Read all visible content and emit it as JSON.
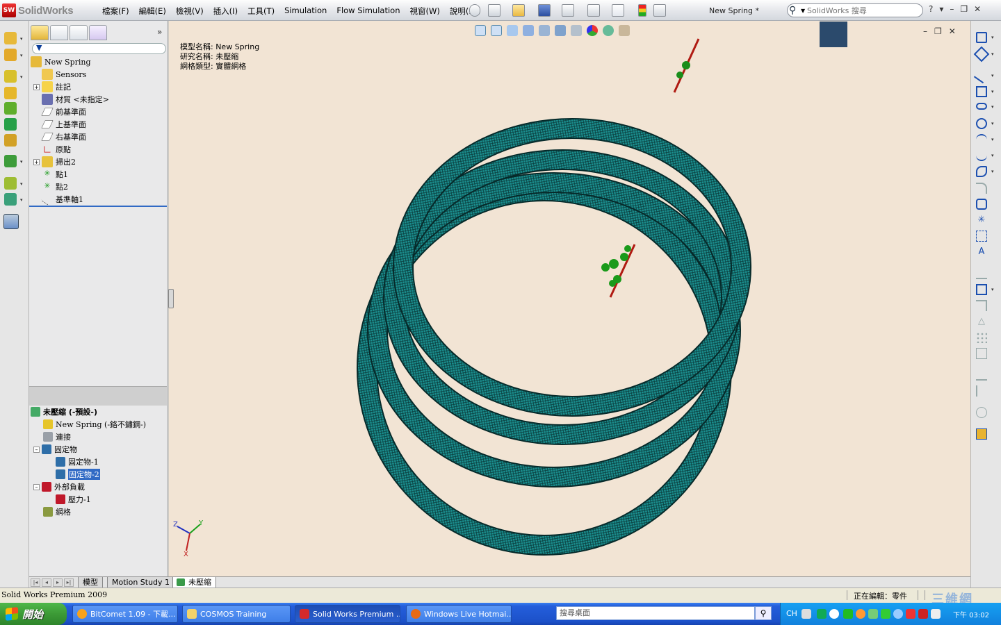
{
  "app": {
    "logo_text": "SolidWorks",
    "logo_badge": "SW",
    "document_title": "New Spring *",
    "menus": [
      "檔案(F)",
      "編輯(E)",
      "檢視(V)",
      "插入(I)",
      "工具(T)",
      "Simulation",
      "Flow Simulation",
      "視窗(W)",
      "說明(H)"
    ],
    "search_placeholder": "SolidWorks 搜尋",
    "window_controls": [
      "?",
      "▾",
      "–",
      "❐",
      "✕"
    ]
  },
  "feature_tree": {
    "root": "New Spring",
    "items": [
      {
        "label": "Sensors",
        "icon": "sensors-icon",
        "expandable": false
      },
      {
        "label": "註記",
        "icon": "annotations-icon",
        "expandable": true
      },
      {
        "label": "材質 <未指定>",
        "icon": "material-icon",
        "expandable": false
      },
      {
        "label": "前基準面",
        "icon": "plane-icon",
        "expandable": false
      },
      {
        "label": "上基準面",
        "icon": "plane-icon",
        "expandable": false
      },
      {
        "label": "右基準面",
        "icon": "plane-icon",
        "expandable": false
      },
      {
        "label": "原點",
        "icon": "origin-icon",
        "expandable": false
      },
      {
        "label": "掃出2",
        "icon": "sweep-icon",
        "expandable": true
      },
      {
        "label": "點1",
        "icon": "point-icon",
        "expandable": false
      },
      {
        "label": "點2",
        "icon": "point-icon",
        "expandable": false
      },
      {
        "label": "基準軸1",
        "icon": "axis-icon",
        "expandable": false
      }
    ]
  },
  "study_tree": {
    "root": "未壓縮 (-預設-)",
    "items": [
      {
        "label": "New Spring (-鉻不鏽鋼-)",
        "icon": "part-icon",
        "indent": 1,
        "expandable": false,
        "selected": false
      },
      {
        "label": "連接",
        "icon": "connections-icon",
        "indent": 1,
        "expandable": false,
        "selected": false
      },
      {
        "label": "固定物",
        "icon": "fixtures-icon",
        "indent": 1,
        "expandable": true,
        "selected": false
      },
      {
        "label": "固定物-1",
        "icon": "fixture-icon",
        "indent": 2,
        "expandable": false,
        "selected": false
      },
      {
        "label": "固定物-2",
        "icon": "fixture-icon",
        "indent": 2,
        "expandable": false,
        "selected": true
      },
      {
        "label": "外部負載",
        "icon": "external-loads-icon",
        "indent": 1,
        "expandable": true,
        "selected": false
      },
      {
        "label": "壓力-1",
        "icon": "pressure-icon",
        "indent": 2,
        "expandable": false,
        "selected": false
      },
      {
        "label": "網格",
        "icon": "mesh-icon",
        "indent": 1,
        "expandable": false,
        "selected": false
      }
    ]
  },
  "viewport": {
    "info": [
      "模型名稱: New Spring",
      "研究名稱: 未壓縮",
      "網格類型: 實體網格"
    ],
    "background": "#f2e4d4",
    "mesh_color": "#1b8f8f",
    "triad": {
      "x": "X",
      "y": "Y",
      "z": "Z"
    },
    "controls": [
      "–",
      "❐",
      "✕"
    ]
  },
  "bottom_tabs": [
    {
      "label": "模型",
      "active": false
    },
    {
      "label": "Motion Study 1",
      "active": false
    },
    {
      "label": "未壓縮",
      "active": true
    }
  ],
  "status": {
    "left": "Solid Works Premium 2009",
    "right": "正在編輯：零件",
    "watermark": "三維網"
  },
  "taskbar": {
    "start_label": "開始",
    "tasks": [
      {
        "label": "BitComet 1.09 - 下載...",
        "icon_color": "#f7a21b",
        "active": false
      },
      {
        "label": "COSMOS Training",
        "icon_color": "#f3d36b",
        "active": false
      },
      {
        "label": "Solid Works Premium ...",
        "icon_color": "#d42a2a",
        "active": true
      },
      {
        "label": "Windows Live Hotmai...",
        "icon_color": "#e86a14",
        "active": false
      }
    ],
    "search_placeholder": "搜尋桌面",
    "tray_lang": "CH",
    "clock": "下午 03:02"
  }
}
